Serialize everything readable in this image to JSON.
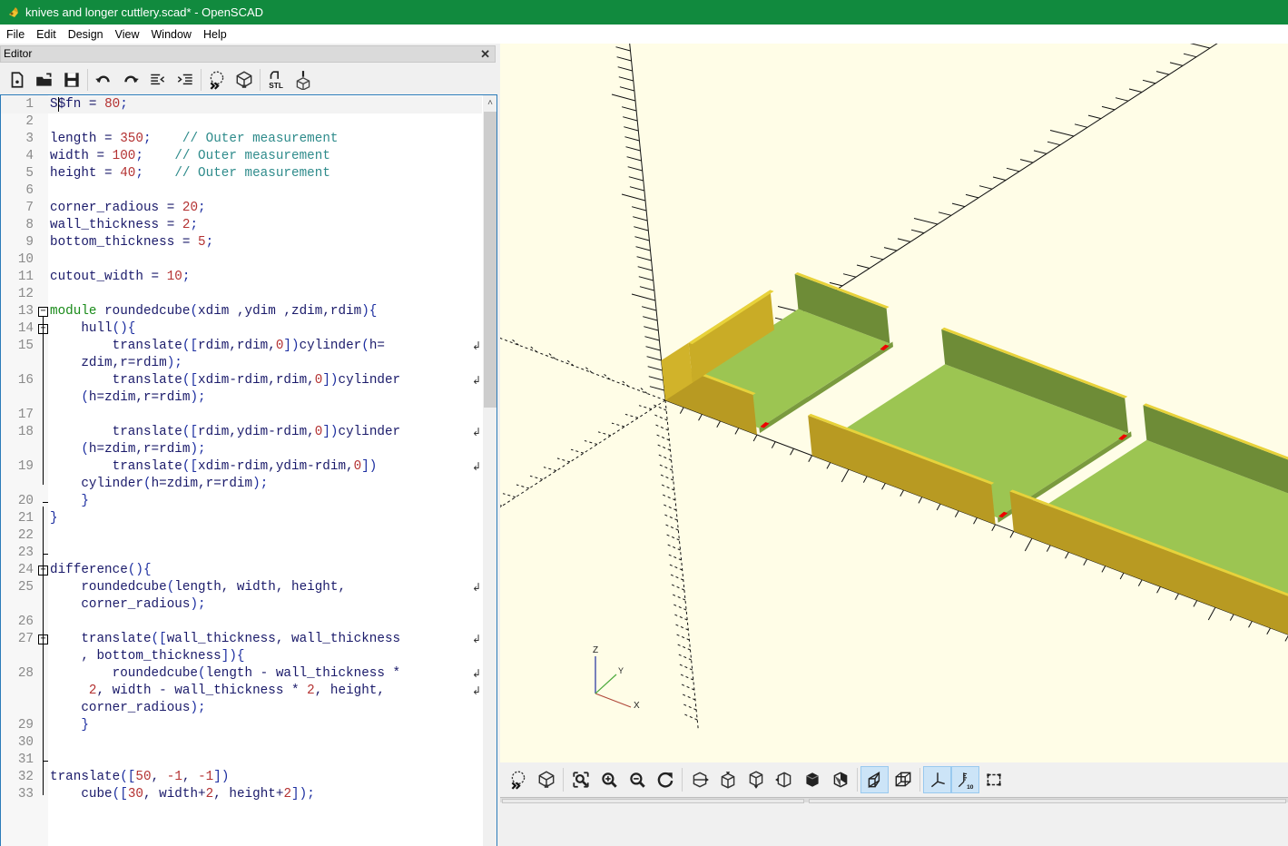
{
  "window": {
    "title": "knives and longer cuttlery.scad* - OpenSCAD"
  },
  "menu": [
    "File",
    "Edit",
    "Design",
    "View",
    "Window",
    "Help"
  ],
  "editor": {
    "title": "Editor",
    "close_label": "✕",
    "toolbar": [
      {
        "name": "new-file-icon"
      },
      {
        "name": "open-file-icon"
      },
      {
        "name": "save-icon"
      },
      {
        "sep": true
      },
      {
        "name": "undo-icon"
      },
      {
        "name": "redo-icon"
      },
      {
        "name": "unindent-icon"
      },
      {
        "name": "indent-icon"
      },
      {
        "sep": true
      },
      {
        "name": "preview-icon"
      },
      {
        "name": "render-icon"
      },
      {
        "sep": true
      },
      {
        "name": "export-stl-icon",
        "label": "STL"
      },
      {
        "name": "send-to-printer-icon"
      }
    ],
    "lines": [
      {
        "n": "1",
        "tokens": [
          [
            "t",
            "S$fn = "
          ],
          [
            "num",
            "80"
          ],
          [
            "pn",
            ";"
          ]
        ],
        "current": true
      },
      {
        "n": "2",
        "tokens": []
      },
      {
        "n": "3",
        "tokens": [
          [
            "t",
            "length = "
          ],
          [
            "num",
            "350"
          ],
          [
            "pn",
            ";"
          ],
          [
            "t",
            "    "
          ],
          [
            "cmt",
            "// Outer measurement"
          ]
        ]
      },
      {
        "n": "4",
        "tokens": [
          [
            "t",
            "width = "
          ],
          [
            "num",
            "100"
          ],
          [
            "pn",
            ";"
          ],
          [
            "t",
            "    "
          ],
          [
            "cmt",
            "// Outer measurement"
          ]
        ]
      },
      {
        "n": "5",
        "tokens": [
          [
            "t",
            "height = "
          ],
          [
            "num",
            "40"
          ],
          [
            "pn",
            ";"
          ],
          [
            "t",
            "    "
          ],
          [
            "cmt",
            "// Outer measurement"
          ]
        ]
      },
      {
        "n": "6",
        "tokens": []
      },
      {
        "n": "7",
        "tokens": [
          [
            "t",
            "corner_radious = "
          ],
          [
            "num",
            "20"
          ],
          [
            "pn",
            ";"
          ]
        ]
      },
      {
        "n": "8",
        "tokens": [
          [
            "t",
            "wall_thickness = "
          ],
          [
            "num",
            "2"
          ],
          [
            "pn",
            ";"
          ]
        ]
      },
      {
        "n": "9",
        "tokens": [
          [
            "t",
            "bottom_thickness = "
          ],
          [
            "num",
            "5"
          ],
          [
            "pn",
            ";"
          ]
        ]
      },
      {
        "n": "10",
        "tokens": []
      },
      {
        "n": "11",
        "tokens": [
          [
            "t",
            "cutout_width = "
          ],
          [
            "num",
            "10"
          ],
          [
            "pn",
            ";"
          ]
        ]
      },
      {
        "n": "12",
        "tokens": []
      },
      {
        "n": "13",
        "tokens": [
          [
            "kw",
            "module"
          ],
          [
            "t",
            " roundedcube"
          ],
          [
            "pn",
            "("
          ],
          [
            "t",
            "xdim ,ydim ,zdim,rdim"
          ],
          [
            "pn",
            "){"
          ]
        ],
        "fold": "open"
      },
      {
        "n": "14",
        "tokens": [
          [
            "t",
            "    hull"
          ],
          [
            "pn",
            "(){"
          ]
        ],
        "fold": "open"
      },
      {
        "n": "15",
        "tokens": [
          [
            "t",
            "        translate"
          ],
          [
            "pn",
            "(["
          ],
          [
            "t",
            "rdim,rdim,"
          ],
          [
            "num",
            "0"
          ],
          [
            "pn",
            "])"
          ],
          [
            "t",
            "cylinder"
          ],
          [
            "pn",
            "("
          ],
          [
            "t",
            "h="
          ]
        ],
        "wrap": true
      },
      {
        "n": "",
        "tokens": [
          [
            "t",
            "    zdim,r=rdim"
          ],
          [
            "pn",
            ");"
          ]
        ]
      },
      {
        "n": "16",
        "tokens": [
          [
            "t",
            "        translate"
          ],
          [
            "pn",
            "(["
          ],
          [
            "t",
            "xdim-rdim,rdim,"
          ],
          [
            "num",
            "0"
          ],
          [
            "pn",
            "])"
          ],
          [
            "t",
            "cylinder"
          ]
        ],
        "wrap": true
      },
      {
        "n": "",
        "tokens": [
          [
            "t",
            "    "
          ],
          [
            "pn",
            "("
          ],
          [
            "t",
            "h=zdim,r=rdim"
          ],
          [
            "pn",
            ");"
          ]
        ]
      },
      {
        "n": "17",
        "tokens": []
      },
      {
        "n": "18",
        "tokens": [
          [
            "t",
            "        translate"
          ],
          [
            "pn",
            "(["
          ],
          [
            "t",
            "rdim,ydim-rdim,"
          ],
          [
            "num",
            "0"
          ],
          [
            "pn",
            "])"
          ],
          [
            "t",
            "cylinder"
          ]
        ],
        "wrap": true
      },
      {
        "n": "",
        "tokens": [
          [
            "t",
            "    "
          ],
          [
            "pn",
            "("
          ],
          [
            "t",
            "h=zdim,r=rdim"
          ],
          [
            "pn",
            ");"
          ]
        ]
      },
      {
        "n": "19",
        "tokens": [
          [
            "t",
            "        translate"
          ],
          [
            "pn",
            "(["
          ],
          [
            "t",
            "xdim-rdim,ydim-rdim,"
          ],
          [
            "num",
            "0"
          ],
          [
            "pn",
            "])"
          ]
        ],
        "wrap": true
      },
      {
        "n": "",
        "tokens": [
          [
            "t",
            "    cylinder"
          ],
          [
            "pn",
            "("
          ],
          [
            "t",
            "h=zdim,r=rdim"
          ],
          [
            "pn",
            ");"
          ]
        ]
      },
      {
        "n": "20",
        "tokens": [
          [
            "t",
            "    "
          ],
          [
            "pn",
            "}"
          ]
        ],
        "foldend": true
      },
      {
        "n": "21",
        "tokens": [
          [
            "pn",
            "}"
          ]
        ]
      },
      {
        "n": "22",
        "tokens": []
      },
      {
        "n": "23",
        "tokens": [],
        "foldend": true
      },
      {
        "n": "24",
        "tokens": [
          [
            "t",
            "difference"
          ],
          [
            "pn",
            "(){"
          ]
        ],
        "fold": "open"
      },
      {
        "n": "25",
        "tokens": [
          [
            "t",
            "    roundedcube"
          ],
          [
            "pn",
            "("
          ],
          [
            "t",
            "length, width, height,"
          ]
        ],
        "wrap": true
      },
      {
        "n": "",
        "tokens": [
          [
            "t",
            "    corner_radious"
          ],
          [
            "pn",
            ");"
          ]
        ]
      },
      {
        "n": "26",
        "tokens": []
      },
      {
        "n": "27",
        "tokens": [
          [
            "t",
            "    translate"
          ],
          [
            "pn",
            "(["
          ],
          [
            "t",
            "wall_thickness, wall_thickness"
          ]
        ],
        "wrap": true,
        "fold": "open"
      },
      {
        "n": "",
        "tokens": [
          [
            "t",
            "    , bottom_thickness"
          ],
          [
            "pn",
            "]){"
          ]
        ]
      },
      {
        "n": "28",
        "tokens": [
          [
            "t",
            "        roundedcube"
          ],
          [
            "pn",
            "("
          ],
          [
            "t",
            "length - wall_thickness *"
          ]
        ],
        "wrap": true
      },
      {
        "n": "",
        "tokens": [
          [
            "t",
            "     "
          ],
          [
            "num",
            "2"
          ],
          [
            "t",
            ", width - wall_thickness * "
          ],
          [
            "num",
            "2"
          ],
          [
            "t",
            ", height,"
          ]
        ],
        "wrap": true
      },
      {
        "n": "",
        "tokens": [
          [
            "t",
            "    corner_radious"
          ],
          [
            "pn",
            ");"
          ]
        ]
      },
      {
        "n": "29",
        "tokens": [
          [
            "t",
            "    "
          ],
          [
            "pn",
            "}"
          ]
        ]
      },
      {
        "n": "30",
        "tokens": []
      },
      {
        "n": "31",
        "tokens": [],
        "foldend": true
      },
      {
        "n": "32",
        "tokens": [
          [
            "t",
            "translate"
          ],
          [
            "pn",
            "(["
          ],
          [
            "num",
            "50"
          ],
          [
            "t",
            ", "
          ],
          [
            "num",
            "-1"
          ],
          [
            "t",
            ", "
          ],
          [
            "num",
            "-1"
          ],
          [
            "pn",
            "])"
          ]
        ]
      },
      {
        "n": "33",
        "tokens": [
          [
            "t",
            "    cube"
          ],
          [
            "pn",
            "(["
          ],
          [
            "num",
            "30"
          ],
          [
            "t",
            ", width+"
          ],
          [
            "num",
            "2"
          ],
          [
            "t",
            ", height+"
          ],
          [
            "num",
            "2"
          ],
          [
            "pn",
            "]);"
          ]
        ]
      }
    ]
  },
  "viewer": {
    "axis_labels": {
      "x": "X",
      "y": "Y",
      "z": "Z"
    },
    "colors": {
      "background": "#fffde7",
      "wall_outer": "#b89a22",
      "wall_top": "#e8d23a",
      "wall_inner": "#6e8c37",
      "floor": "#9cc552",
      "cutout": "#ee0000"
    },
    "toolbar": [
      {
        "name": "preview-icon"
      },
      {
        "name": "render-icon"
      },
      {
        "sep": true
      },
      {
        "name": "view-all-icon"
      },
      {
        "name": "zoom-in-icon"
      },
      {
        "name": "zoom-out-icon"
      },
      {
        "name": "reset-view-icon"
      },
      {
        "sep": true
      },
      {
        "name": "view-right-icon"
      },
      {
        "name": "view-top-icon"
      },
      {
        "name": "view-bottom-icon"
      },
      {
        "name": "view-left-icon"
      },
      {
        "name": "view-front-icon"
      },
      {
        "name": "view-back-icon"
      },
      {
        "sep": true
      },
      {
        "name": "perspective-icon",
        "active": true
      },
      {
        "name": "orthogonal-icon"
      },
      {
        "sep": true
      },
      {
        "name": "show-axes-icon",
        "active": true
      },
      {
        "name": "show-scale-markers-icon",
        "active": true,
        "label": "10"
      },
      {
        "name": "show-edges-icon"
      }
    ]
  }
}
